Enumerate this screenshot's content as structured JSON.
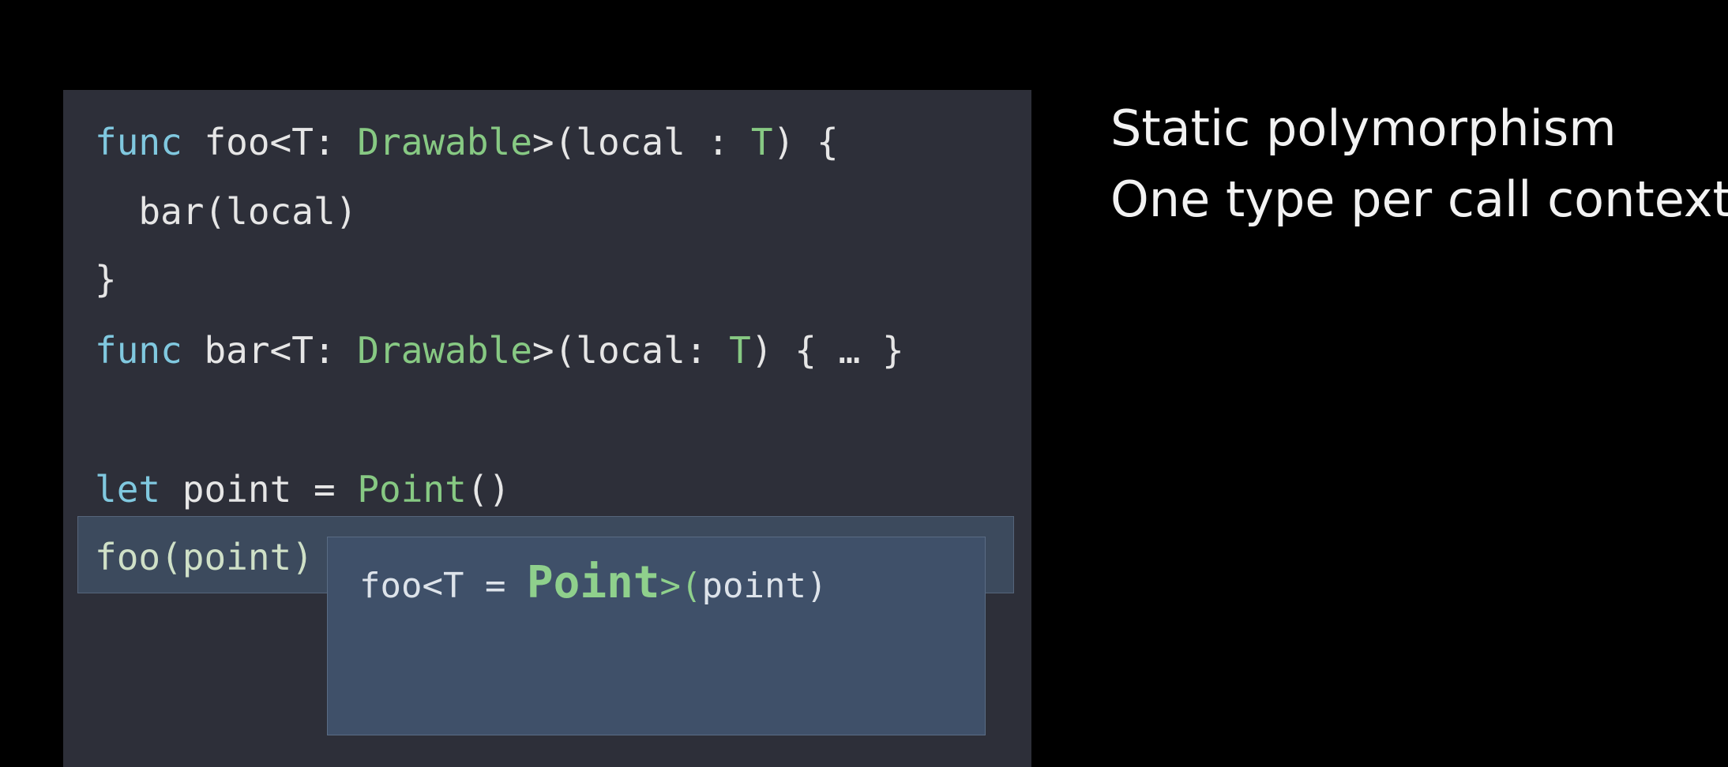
{
  "code": {
    "line1": {
      "kw_func": "func",
      "name": " foo<T: ",
      "type": "Drawable",
      "rest1": ">(local : ",
      "t": "T",
      "rest2": ") {"
    },
    "line2": {
      "text": "  bar(local)"
    },
    "line3": {
      "text": "}"
    },
    "line4": {
      "kw_func": "func",
      "name": " bar<T: ",
      "type": "Drawable",
      "rest1": ">(local: ",
      "t": "T",
      "rest2": ") { … }"
    },
    "line5": {
      "kw_let": "let",
      "name": " point = ",
      "type": "Point",
      "rest": "()"
    },
    "line6": {
      "call": "foo(",
      "arg": "point",
      "close": ")"
    }
  },
  "popup": {
    "prefix": "foo<T = ",
    "type": "Point",
    "suffix_open": ">(",
    "arg": "point",
    "suffix_close": ")"
  },
  "bullets": [
    "Static polymorphism",
    "One type per call context"
  ],
  "colors": {
    "background": "#000000",
    "code_panel": "#2d2f39",
    "keyword": "#80c8df",
    "type": "#87c983",
    "highlight": "#3c4a5d",
    "popup": "#3f5069"
  }
}
